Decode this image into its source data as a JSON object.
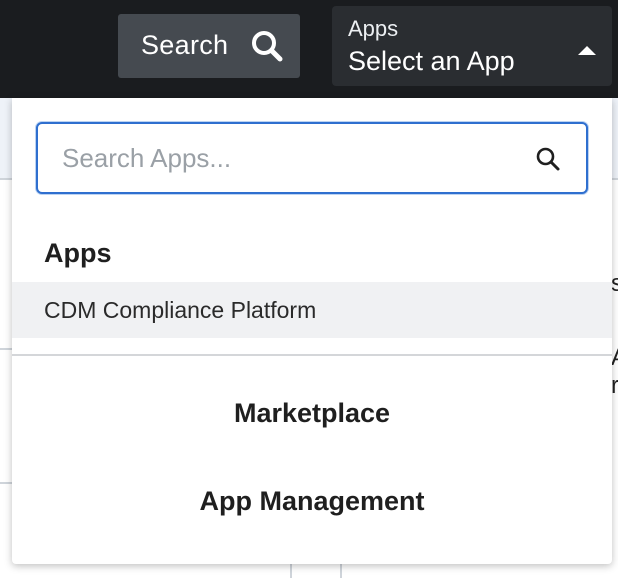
{
  "topbar": {
    "search_label": "Search",
    "search_icon": "search-icon",
    "app_selector": {
      "label": "Apps",
      "value": "Select an App",
      "caret_icon": "caret-up-icon"
    }
  },
  "background": {
    "fragments": [
      "s",
      "A",
      "r"
    ]
  },
  "dropdown": {
    "search": {
      "placeholder": "Search Apps...",
      "value": "",
      "icon": "search-icon"
    },
    "section_heading": "Apps",
    "apps": [
      {
        "label": "CDM Compliance Platform"
      }
    ],
    "links": {
      "marketplace": "Marketplace",
      "app_management": "App Management"
    }
  },
  "colors": {
    "topbar_bg": "#1a1c1f",
    "search_button_bg": "#454a50",
    "app_selector_bg": "#2a2d31",
    "focus_border": "#2f6fcf",
    "item_hover_bg": "#f0f1f3"
  }
}
